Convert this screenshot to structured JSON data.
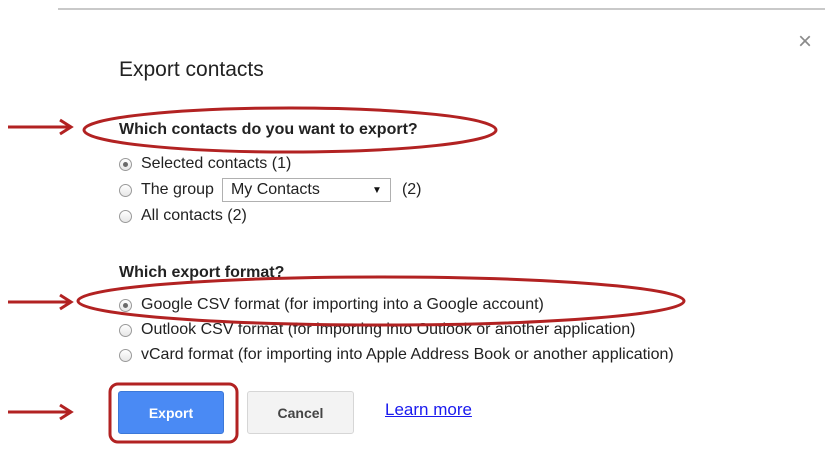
{
  "dialog": {
    "title": "Export contacts",
    "close_glyph": "×"
  },
  "contacts_section": {
    "heading": "Which contacts do you want to export?",
    "options": [
      {
        "label": "Selected contacts (1)",
        "checked": true
      },
      {
        "label": "The group",
        "checked": false
      },
      {
        "label": "All contacts (2)",
        "checked": false
      }
    ],
    "group_select": {
      "value": "My Contacts",
      "count": "(2)"
    }
  },
  "format_section": {
    "heading": "Which export format?",
    "options": [
      {
        "label": "Google CSV format (for importing into a Google account)",
        "checked": true
      },
      {
        "label": "Outlook CSV format (for importing into Outlook or another application)",
        "checked": false
      },
      {
        "label": "vCard format (for importing into Apple Address Book or another application)",
        "checked": false
      }
    ]
  },
  "actions": {
    "export_label": "Export",
    "cancel_label": "Cancel",
    "learn_more_label": "Learn more"
  },
  "annotations": {
    "color": "#b22222",
    "icons": [
      "arrow-right",
      "ellipse-highlight",
      "rounded-rect-highlight"
    ]
  }
}
